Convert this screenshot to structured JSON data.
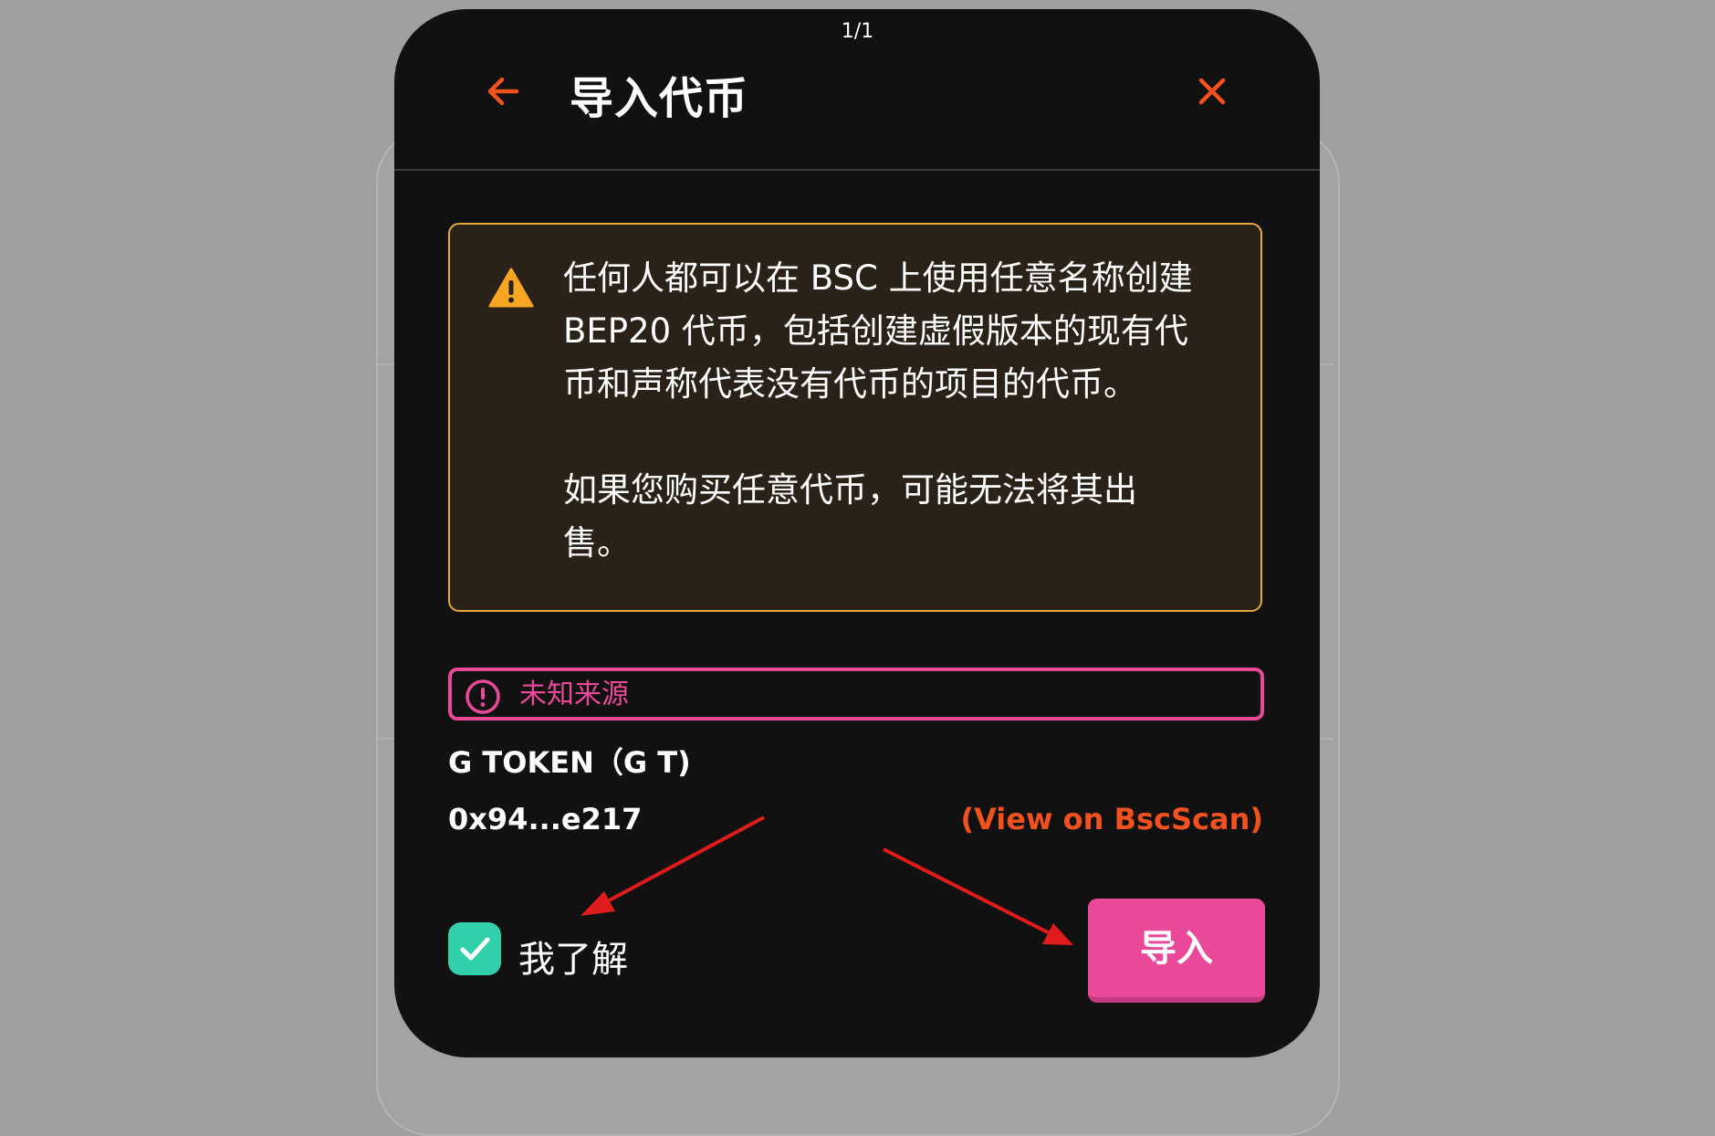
{
  "page_counter": "1/1",
  "modal": {
    "title": "导入代币",
    "back_icon": "arrow-left-icon",
    "close_icon": "close-icon"
  },
  "warning": {
    "icon": "warning-triangle-icon",
    "paragraph1_line1": "任何人都可以在 BSC 上使用任意名称创建",
    "paragraph1_line2": "BEP20 代币，包括创建虚假版本的现有代",
    "paragraph1_line3": "币和声称代表没有代币的项目的代币。",
    "paragraph2_line1": "如果您购买任意代币，可能无法将其出",
    "paragraph2_line2": "售。"
  },
  "source_badge": {
    "icon": "exclamation-circle-icon",
    "label": "未知来源"
  },
  "token": {
    "name": "G TOKEN（G T)",
    "address": "0x94...e217",
    "explorer_link": "(View on BscScan)"
  },
  "acknowledge": {
    "checked": true,
    "label": "我了解"
  },
  "import_button": {
    "label": "导入"
  },
  "colors": {
    "accent_orange": "#f0511e",
    "pink": "#ea4899",
    "teal": "#31d0aa",
    "warning_border": "#e8a83a",
    "modal_bg": "#111111",
    "annotation_red": "#e01b1b"
  }
}
